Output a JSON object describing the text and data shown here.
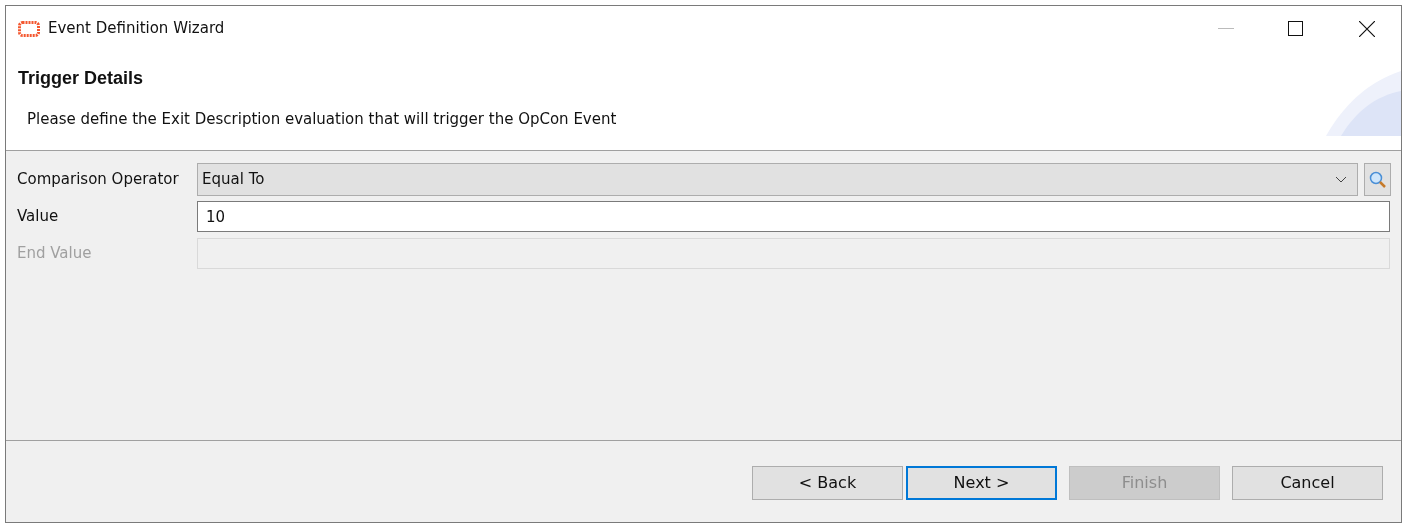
{
  "window": {
    "title": "Event Definition Wizard"
  },
  "header": {
    "title": "Trigger Details",
    "description": "Please define the Exit Description evaluation that will trigger the OpCon Event"
  },
  "fields": [
    {
      "kind": "select",
      "label": "Comparison Operator",
      "value": "Equal To",
      "disabled": false
    },
    {
      "kind": "text",
      "label": "Value",
      "value": "10",
      "disabled": false
    },
    {
      "kind": "text",
      "label": "End Value",
      "disabled": true
    }
  ],
  "buttons": [
    {
      "label": "< Back",
      "disabled": false,
      "selected": false
    },
    {
      "label": "Next >",
      "disabled": false,
      "selected": true
    },
    {
      "label": "Finish",
      "disabled": true,
      "selected": false
    },
    {
      "label": "Cancel",
      "disabled": false,
      "selected": false
    }
  ]
}
